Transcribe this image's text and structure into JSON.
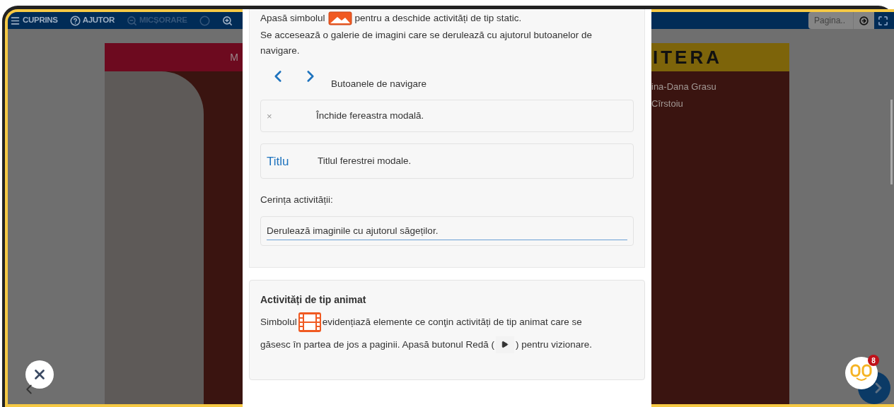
{
  "toolbar": {
    "items": [
      {
        "kind": "contents",
        "label": "CUPRINS",
        "disabled": false
      },
      {
        "kind": "help",
        "label": "AJUTOR",
        "disabled": false
      },
      {
        "kind": "zoom_out",
        "label": "MICȘORARE",
        "disabled": true
      },
      {
        "kind": "reset",
        "disabled": true
      },
      {
        "kind": "zoom_in",
        "disabled": false
      }
    ],
    "page_field": {
      "placeholder": "Pagina.."
    }
  },
  "book_page": {
    "left_band": "M",
    "right_band": "ITERA",
    "authors": [
      "ina-Dana Grasu",
      "Cîrstoiu"
    ]
  },
  "modal": {
    "intro": {
      "before": "Apasă simbolul",
      "after": "pentru a deschide activități de tip static."
    },
    "gallery_text": "Se accesează o galerie de imagini care se derulează cu ajutorul butoanelor de navigare.",
    "legend": [
      {
        "kind": "nav",
        "text": "Butoanele de navigare"
      },
      {
        "kind": "close",
        "symbol": "×",
        "text": "Închide fereastra modală."
      },
      {
        "kind": "title",
        "symbol": "Titlu",
        "text": "Titlul ferestrei modale."
      }
    ],
    "requirement_label": "Cerința activității:",
    "requirement_value": "Derulează imaginile cu ajutorul săgeților.",
    "animated": {
      "heading": "Activități de tip animat",
      "before": "Simbolul",
      "middle": "evidențiază elemente ce conţin activități de tip animat care se",
      "line2": "găsesc în partea de jos a paginii. Apasă butonul Redă (",
      "after": ") pentru vizionare."
    }
  },
  "mascot": {
    "badge": "8"
  }
}
